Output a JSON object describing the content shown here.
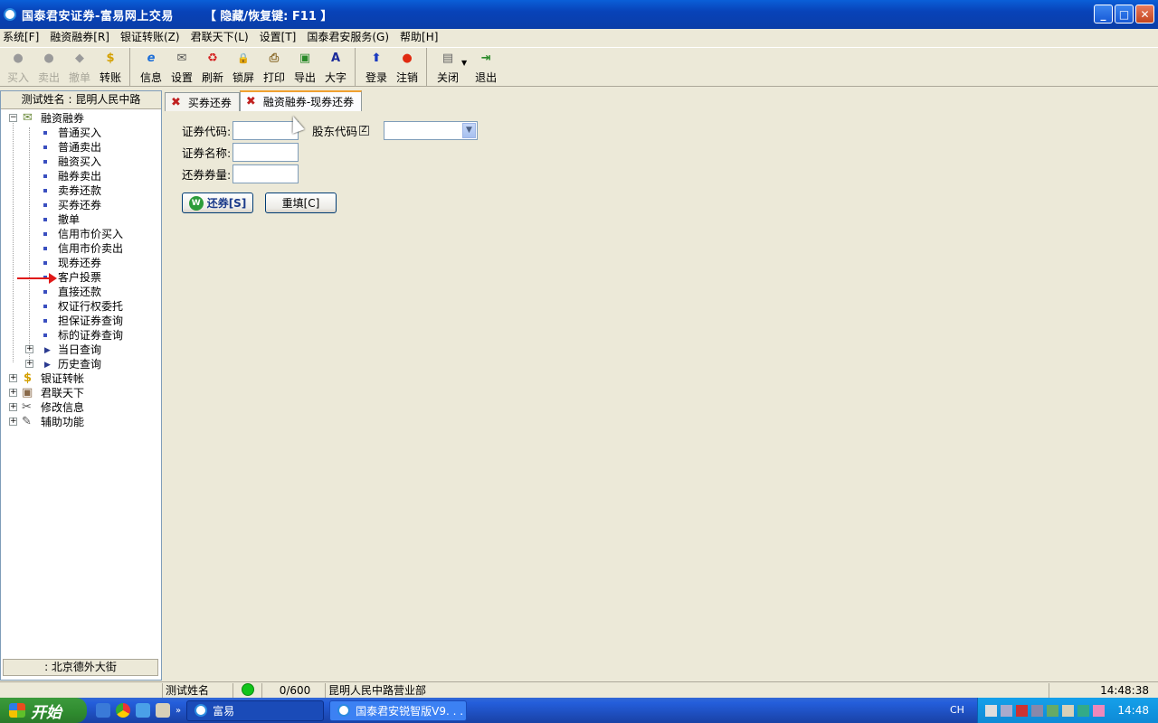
{
  "window": {
    "title": "国泰君安证券-富易网上交易",
    "hotkey_hint": "【 隐藏/恢复键: F11 】",
    "min": "_",
    "max": "□",
    "close": "✕"
  },
  "menu": [
    "系统[F]",
    "融资融券[R]",
    "银证转账(Z)",
    "君联天下(L)",
    "设置[T]",
    "国泰君安服务(G)",
    "帮助[H]"
  ],
  "toolbar": {
    "group1": [
      {
        "label": "买入",
        "icon": "●"
      },
      {
        "label": "卖出",
        "icon": "●"
      },
      {
        "label": "撤单",
        "icon": "◆"
      },
      {
        "label": "转账",
        "icon": "$"
      }
    ],
    "group2": [
      {
        "label": "信息",
        "icon": "e"
      },
      {
        "label": "设置",
        "icon": "✉"
      },
      {
        "label": "刷新",
        "icon": "♻"
      },
      {
        "label": "锁屏",
        "icon": "🔒"
      },
      {
        "label": "打印",
        "icon": "⎙"
      },
      {
        "label": "导出",
        "icon": "▣"
      },
      {
        "label": "大字",
        "icon": "A"
      }
    ],
    "group3": [
      {
        "label": "登录",
        "icon": "⬆"
      },
      {
        "label": "注销",
        "icon": "●"
      }
    ],
    "group4": [
      {
        "label": "关闭",
        "icon": "▤"
      },
      {
        "label": "退出",
        "icon": "⇥"
      }
    ],
    "dropdown_arrow": "▼"
  },
  "sidebar": {
    "header": "测试姓名 : 昆明人民中路",
    "footer": ": 北京德外大街",
    "root1": "融资融券",
    "items": [
      "普通买入",
      "普通卖出",
      "融资买入",
      "融券卖出",
      "卖券还款",
      "买券还券",
      "撤单",
      "信用市价买入",
      "信用市价卖出",
      "现券还券",
      "客户投票",
      "直接还款",
      "权证行权委托",
      "担保证券查询",
      "标的证券查询"
    ],
    "sub": [
      "当日查询",
      "历史查询"
    ],
    "roots": [
      "银证转帐",
      "君联天下",
      "修改信息",
      "辅助功能"
    ],
    "expand_minus": "−",
    "expand_plus": "+"
  },
  "tabs": [
    {
      "label": "买券还券",
      "close": "✖"
    },
    {
      "label": "融资融券-现券还券",
      "close": "✖"
    }
  ],
  "form": {
    "code_label": "证券代码:",
    "holder_label": "股东代码",
    "holder_key": "Z",
    "name_label": "证券名称:",
    "qty_label": "还券券量:",
    "code_value": "",
    "name_value": "",
    "qty_value": "",
    "submit_label": "还券[S]",
    "submit_icon": "W",
    "reset_label": "重填[C]"
  },
  "status": {
    "name": "测试姓名",
    "count": "0/600",
    "branch": "昆明人民中路营业部",
    "time": "14:48:38"
  },
  "taskbar": {
    "start": "开始",
    "tasks": [
      "富易",
      "国泰君安锐智版V9. . ."
    ],
    "lang": "CH",
    "clock": "14:48"
  }
}
